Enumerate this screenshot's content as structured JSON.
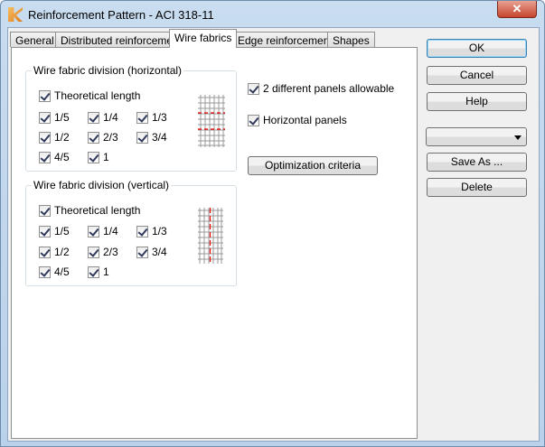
{
  "window": {
    "title": "Reinforcement Pattern - ACI 318-11",
    "close_glyph": "✕"
  },
  "tabs": [
    "General",
    "Distributed reinforcement",
    "Wire fabrics",
    "Edge reinforcement",
    "Shapes"
  ],
  "horizontal": {
    "label": "Wire fabric division (horizontal)",
    "theoretical": "Theoretical length",
    "options": [
      "1/5",
      "1/4",
      "1/3",
      "1/2",
      "2/3",
      "3/4",
      "4/5",
      "1"
    ]
  },
  "vertical": {
    "label": "Wire fabric division (vertical)",
    "theoretical": "Theoretical length",
    "options": [
      "1/5",
      "1/4",
      "1/3",
      "1/2",
      "2/3",
      "3/4",
      "4/5",
      "1"
    ]
  },
  "options": {
    "two_panels": "2 different panels allowable",
    "horizontal_panels": "Horizontal panels",
    "optimization": "Optimization criteria"
  },
  "buttons": {
    "ok": "OK",
    "cancel": "Cancel",
    "help": "Help",
    "save_as": "Save As ...",
    "delete": "Delete"
  },
  "dropdown": {
    "value": ""
  }
}
